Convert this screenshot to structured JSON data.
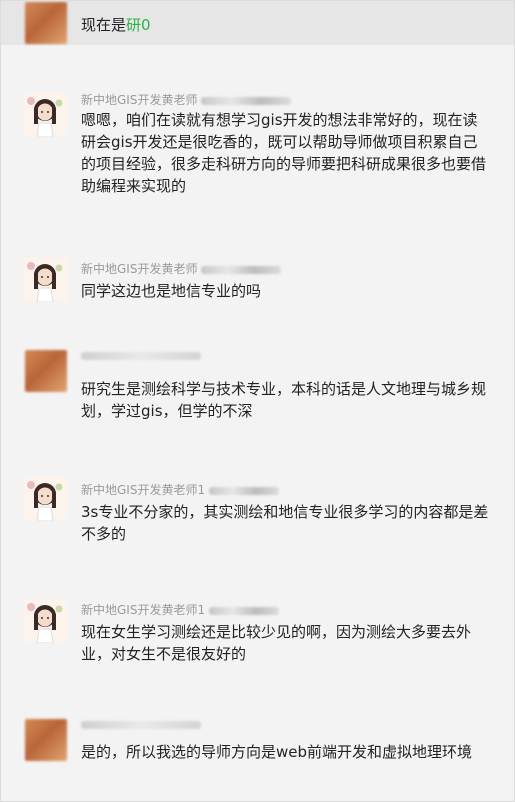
{
  "top_message": {
    "text_prefix": "现在是",
    "text_highlight": "研0"
  },
  "messages": [
    {
      "sender_name": "新中地GIS开发黄老师",
      "text": "嗯嗯，咱们在读就有想学习gis开发的想法非常好的，现在读研会gis开发还是很吃香的，既可以帮助导师做项目积累自己的项目经验，很多走科研方向的导师要把科研成果很多也要借助编程来实现的"
    },
    {
      "sender_name": "新中地GIS开发黄老师",
      "text": "同学这边也是地信专业的吗"
    },
    {
      "sender_name": "",
      "text": "研究生是测绘科学与技术专业，本科的话是人文地理与城乡规划，学过gis，但学的不深"
    },
    {
      "sender_name": "新中地GIS开发黄老师1",
      "text": "3s专业不分家的，其实测绘和地信专业很多学习的内容都是差不多的"
    },
    {
      "sender_name": "新中地GIS开发黄老师1",
      "text": "现在女生学习测绘还是比较少见的啊，因为测绘大多要去外业，对女生不是很友好的"
    },
    {
      "sender_name": "",
      "text": "是的，所以我选的导师方向是web前端开发和虚拟地理环境"
    }
  ]
}
